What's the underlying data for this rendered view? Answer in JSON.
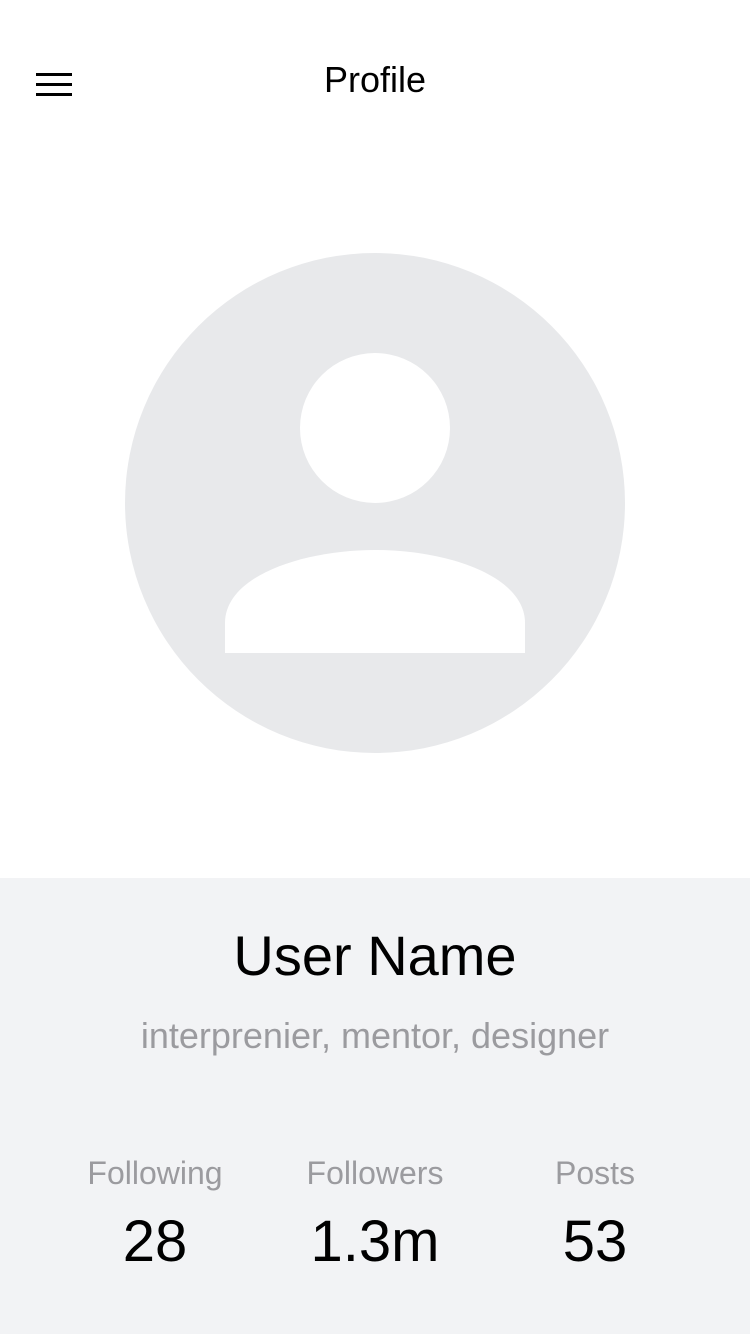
{
  "header": {
    "title": "Profile",
    "menu_icon": "hamburger-menu-icon"
  },
  "avatar": {
    "icon": "user-placeholder-icon",
    "background_color": "#e8e9eb",
    "figure_color": "#ffffff"
  },
  "profile": {
    "name": "User Name",
    "bio": "interprenier, mentor, designer",
    "panel_color": "#f2f3f5"
  },
  "stats": [
    {
      "label": "Following",
      "value": "28"
    },
    {
      "label": "Followers",
      "value": "1.3m"
    },
    {
      "label": "Posts",
      "value": "53"
    }
  ]
}
